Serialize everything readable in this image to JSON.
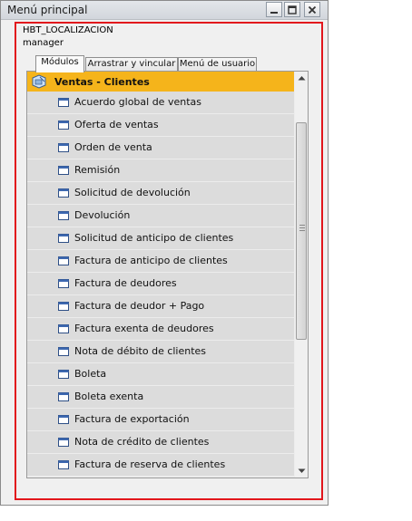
{
  "window": {
    "title": "Menú principal",
    "buttons": {
      "minimize_icon": "minimize-icon",
      "maximize_icon": "maximize-icon",
      "close_icon": "close-icon"
    }
  },
  "info": {
    "company": "HBT_LOCALIZACION",
    "user": "manager"
  },
  "tabs": [
    {
      "label": "Módulos",
      "active": true
    },
    {
      "label": "Arrastrar y vincular",
      "active": false
    },
    {
      "label": "Menú de usuario",
      "active": false
    }
  ],
  "module": {
    "label": "Ventas - Clientes",
    "color": "#f5b41b",
    "icon": "sales-module-icon"
  },
  "items": [
    {
      "label": "Acuerdo global de ventas"
    },
    {
      "label": "Oferta de ventas"
    },
    {
      "label": "Orden de venta"
    },
    {
      "label": "Remisión"
    },
    {
      "label": "Solicitud de devolución"
    },
    {
      "label": "Devolución"
    },
    {
      "label": "Solicitud de anticipo de clientes"
    },
    {
      "label": "Factura de anticipo de clientes"
    },
    {
      "label": "Factura de deudores"
    },
    {
      "label": "Factura de deudor + Pago"
    },
    {
      "label": "Factura exenta de deudores"
    },
    {
      "label": "Nota de débito de clientes"
    },
    {
      "label": "Boleta"
    },
    {
      "label": "Boleta exenta"
    },
    {
      "label": "Factura de exportación"
    },
    {
      "label": "Nota de crédito de clientes"
    },
    {
      "label": "Factura de reserva de clientes"
    }
  ],
  "highlight_color": "#e2161c"
}
